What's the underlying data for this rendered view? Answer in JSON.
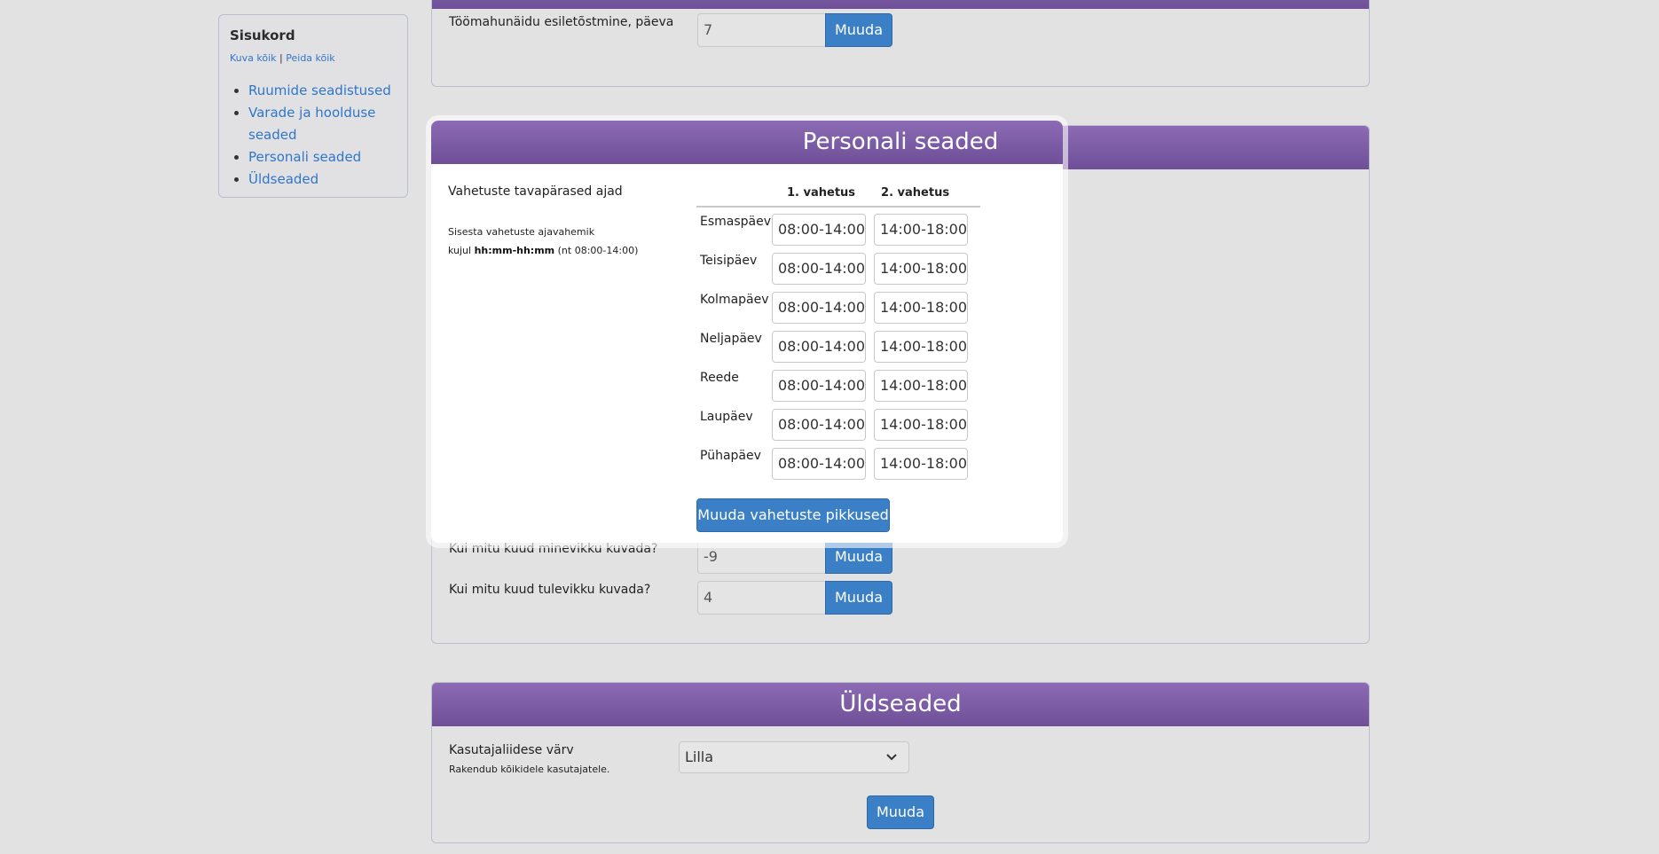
{
  "toc": {
    "title": "Sisukord",
    "show_all": "Kuva kõik",
    "separator": "|",
    "hide_all": "Peida kõik",
    "items": [
      "Ruumide seadistused",
      "Varade ja hoolduse seaded",
      "Personali seaded",
      "Üldseaded"
    ]
  },
  "top_section": {
    "label": "Töömahunäidu esiletõstmine, päeva",
    "value": "7",
    "button": "Muuda"
  },
  "personal": {
    "title": "Personali seaded",
    "shifts_title": "Vahetuste tavapärased ajad",
    "hint_line1": "Sisesta vahetuste ajavahemik",
    "hint_prefix": "kujul",
    "hint_format": "hh:mm-hh:mm",
    "hint_example": "(nt 08:00-14:00)",
    "col1": "1. vahetus",
    "col2": "2. vahetus",
    "days": [
      {
        "name": "Esmaspäev",
        "shift1": "08:00-14:00",
        "shift2": "14:00-18:00"
      },
      {
        "name": "Teisipäev",
        "shift1": "08:00-14:00",
        "shift2": "14:00-18:00"
      },
      {
        "name": "Kolmapäev",
        "shift1": "08:00-14:00",
        "shift2": "14:00-18:00"
      },
      {
        "name": "Neljapäev",
        "shift1": "08:00-14:00",
        "shift2": "14:00-18:00"
      },
      {
        "name": "Reede",
        "shift1": "08:00-14:00",
        "shift2": "14:00-18:00"
      },
      {
        "name": "Laupäev",
        "shift1": "08:00-14:00",
        "shift2": "14:00-18:00"
      },
      {
        "name": "Pühapäev",
        "shift1": "08:00-14:00",
        "shift2": "14:00-18:00"
      }
    ],
    "shift_button": "Muuda vahetuste pikkused",
    "past_label": "Kui mitu kuud minevikku kuvada?",
    "past_value": "-9",
    "future_label": "Kui mitu kuud tulevikku kuvada?",
    "future_value": "4",
    "button": "Muuda"
  },
  "general": {
    "title": "Üldseaded",
    "color_label": "Kasutajaliidese värv",
    "color_note": "Rakendub kõikidele kasutajatele.",
    "color_value": "Lilla",
    "button": "Muuda"
  },
  "colors": {
    "header_purple": "#7a5aa6",
    "button_blue": "#3b80c6",
    "link_blue": "#2f76c8"
  }
}
